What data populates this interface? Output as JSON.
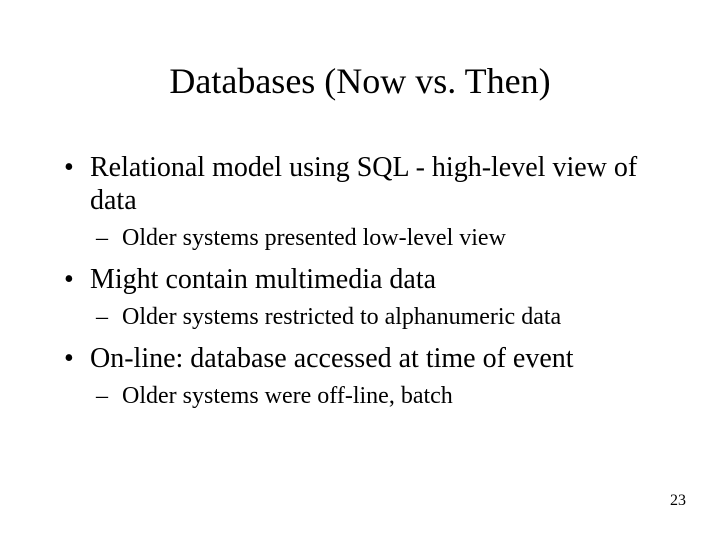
{
  "title": "Databases (Now vs. Then)",
  "bullets": [
    {
      "level": 1,
      "text": "Relational model using SQL - high-level view of data"
    },
    {
      "level": 2,
      "text": "Older systems presented low-level view"
    },
    {
      "level": 1,
      "text": "Might contain multimedia data"
    },
    {
      "level": 2,
      "text": "Older systems restricted to alphanumeric data"
    },
    {
      "level": 1,
      "text": "On-line: database accessed at time of event"
    },
    {
      "level": 2,
      "text": "Older systems were off-line, batch"
    }
  ],
  "page_number": "23"
}
